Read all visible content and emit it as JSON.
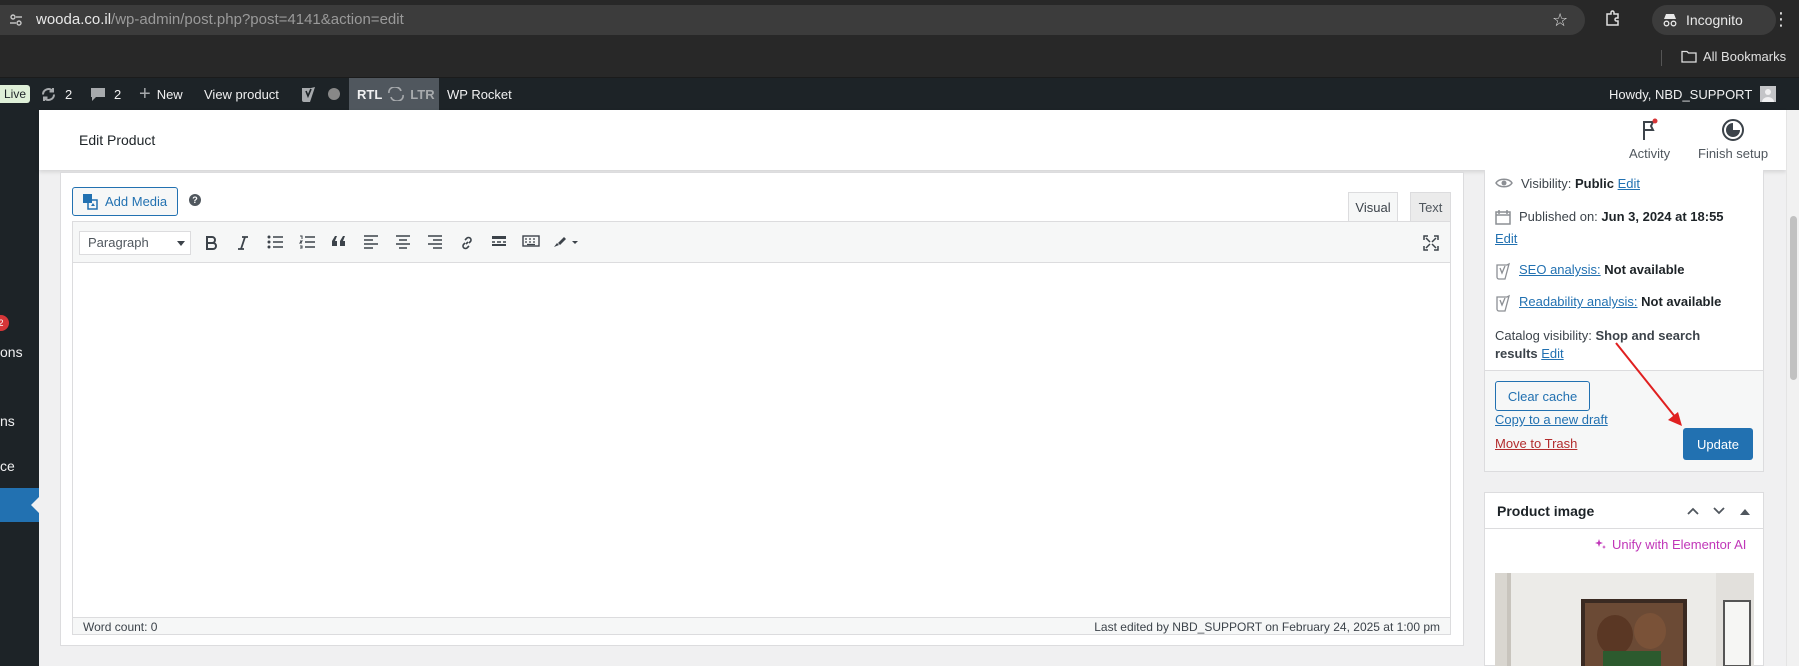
{
  "browser": {
    "url_host": "wooda.co.il",
    "url_path": "/wp-admin/post.php?post=4141&action=edit",
    "profile_label": "Incognito",
    "bookmarks_label": "All Bookmarks"
  },
  "adminbar": {
    "live_label": "Live",
    "updates_count": "2",
    "comments_count": "2",
    "new_label": "New",
    "view_product_label": "View product",
    "rtl_label": "RTL",
    "ltr_label": "LTR",
    "wp_rocket_label": "WP Rocket",
    "howdy_label": "Howdy, NBD_SUPPORT"
  },
  "adminmenu": {
    "badge_count": "2",
    "fragments": [
      "ons",
      "ns",
      "ce"
    ]
  },
  "header": {
    "title": "Edit Product",
    "activity_label": "Activity",
    "finish_setup_label": "Finish setup"
  },
  "editor": {
    "add_media_label": "Add Media",
    "help_glyph": "?",
    "tab_visual": "Visual",
    "tab_text": "Text",
    "format_select_value": "Paragraph",
    "word_count": "Word count: 0",
    "last_edited": "Last edited by NBD_SUPPORT on February 24, 2025 at 1:00 pm"
  },
  "publish": {
    "visibility_label": "Visibility:",
    "visibility_value": "Public",
    "edit_label": "Edit",
    "published_label": "Published on:",
    "published_value": "Jun 3, 2024 at 18:55",
    "seo_label": "SEO analysis:",
    "seo_value": "Not available",
    "readability_label": "Readability analysis:",
    "readability_value": "Not available",
    "catalog_label": "Catalog visibility:",
    "catalog_value_line1": "Shop and search",
    "catalog_value_line2": "results",
    "clear_cache_label": "Clear cache",
    "copy_draft_label": "Copy to a new draft",
    "trash_label": "Move to Trash",
    "update_label": "Update"
  },
  "product_image": {
    "title": "Product image",
    "elementor_link": "Unify with Elementor AI"
  },
  "colors": {
    "wp_blue": "#2271b1",
    "admin_dark": "#1d2327",
    "trash_red": "#b32d2e",
    "elementor_pink": "#c036b8",
    "annotation_red": "#e02020"
  }
}
